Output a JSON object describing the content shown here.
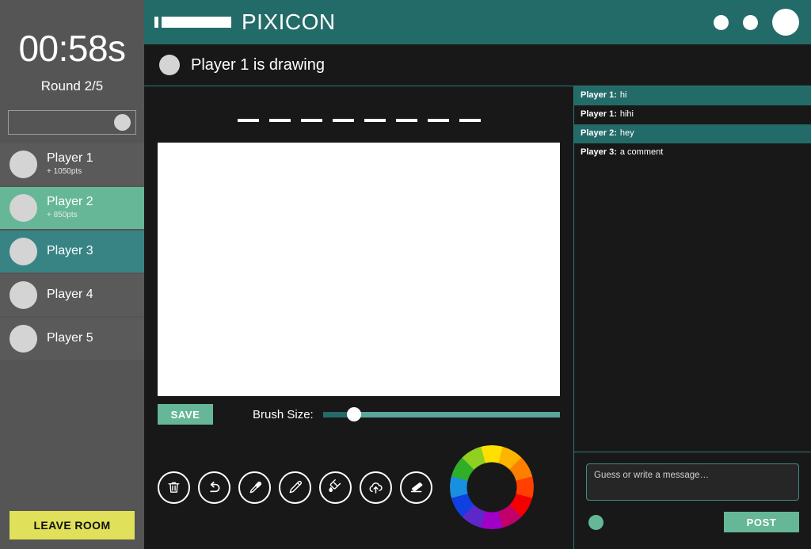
{
  "sidebar": {
    "timer": "00:58s",
    "round": "Round 2/5",
    "search_placeholder": "",
    "search_value": "",
    "players": [
      {
        "name": "Player 1",
        "points": "+ 1050pts",
        "style": "default"
      },
      {
        "name": "Player 2",
        "points": "+ 850pts",
        "style": "green"
      },
      {
        "name": "Player 3",
        "points": "",
        "style": "teal"
      },
      {
        "name": "Player 4",
        "points": "",
        "style": "default"
      },
      {
        "name": "Player 5",
        "points": "",
        "style": "default"
      }
    ],
    "leave_room_label": "LEAVE ROOM"
  },
  "topbar": {
    "brand": "PIXICON",
    "logo_icon": "pencil-bar-logo-icon",
    "actions": [
      {
        "icon": "circle-small-icon"
      },
      {
        "icon": "circle-small-icon"
      },
      {
        "icon": "circle-large-icon"
      }
    ]
  },
  "status": {
    "text": "Player 1 is drawing",
    "avatar_icon": "avatar-circle-icon"
  },
  "stage": {
    "word_blank_count": 8,
    "save_label": "SAVE",
    "brush_label": "Brush Size:",
    "brush_value": 13,
    "tools": [
      {
        "name": "delete-tool",
        "icon": "trash-icon"
      },
      {
        "name": "undo-tool",
        "icon": "undo-arrow-icon"
      },
      {
        "name": "eyedropper-tool",
        "icon": "eyedropper-icon"
      },
      {
        "name": "pencil-tool",
        "icon": "pencil-icon"
      },
      {
        "name": "fill-tool",
        "icon": "paint-bucket-icon"
      },
      {
        "name": "upload-tool",
        "icon": "cloud-upload-icon"
      },
      {
        "name": "eraser-tool",
        "icon": "eraser-icon"
      }
    ],
    "color_wheel": {
      "icon": "color-wheel-icon",
      "segments": [
        "#ffe000",
        "#ffb400",
        "#ff8000",
        "#ff4000",
        "#f40000",
        "#c1006b",
        "#a000c8",
        "#5d28c8",
        "#1040e0",
        "#1a8fe0",
        "#2fae28",
        "#8fd020"
      ]
    }
  },
  "chat": {
    "messages": [
      {
        "who": "Player 1:",
        "text": "hi",
        "highlight": true
      },
      {
        "who": "Player 1:",
        "text": "hihi",
        "highlight": false
      },
      {
        "who": "Player 2:",
        "text": "hey",
        "highlight": true
      },
      {
        "who": "Player 3:",
        "text": "a comment",
        "highlight": false
      }
    ],
    "input_placeholder": "Guess or write a message…",
    "input_value": "",
    "post_label": "POST",
    "status_dot_icon": "status-dot-icon"
  },
  "colors": {
    "teal": "#236b68",
    "green": "#65b797",
    "row_teal": "#388485",
    "yellow": "#e0e05a",
    "sidebar_bg": "#555555",
    "dark_bg": "#181818"
  }
}
